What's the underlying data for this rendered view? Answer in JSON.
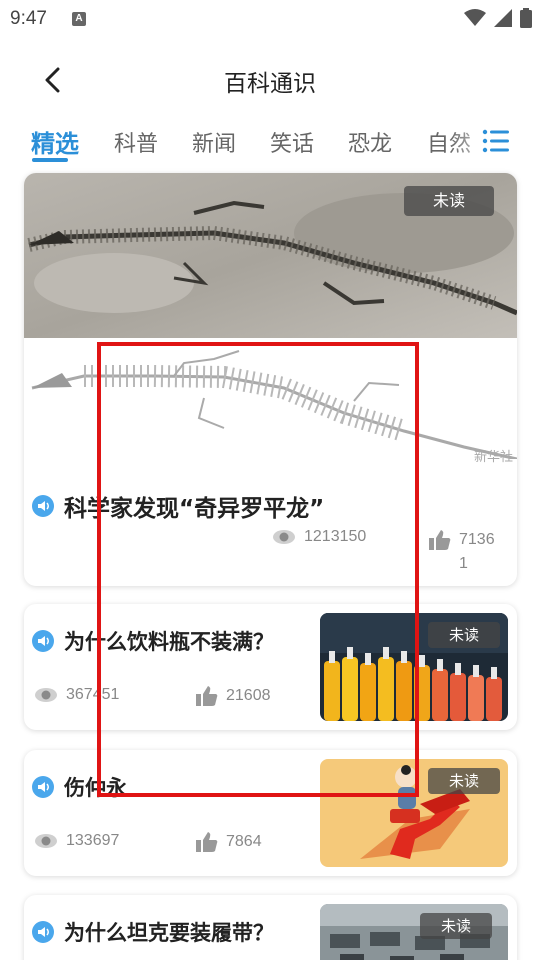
{
  "status_bar": {
    "time": "9:47",
    "notification_glyph": "A",
    "icons": [
      "wifi-icon",
      "signal-icon",
      "battery-icon"
    ]
  },
  "header": {
    "title": "百科通识",
    "back_icon": "chevron-left-icon"
  },
  "tabs": [
    {
      "label": "精选",
      "active": true
    },
    {
      "label": "科普",
      "active": false
    },
    {
      "label": "新闻",
      "active": false
    },
    {
      "label": "笑话",
      "active": false
    },
    {
      "label": "恐龙",
      "active": false
    },
    {
      "label": "自然",
      "active": false
    }
  ],
  "menu_icon": "list-menu-icon",
  "featured": {
    "badge": "未读",
    "watermark": "新华社",
    "title": "科学家发现“奇异罗平龙”",
    "views": "1213150",
    "likes_line1": "7136",
    "likes_line2": "1"
  },
  "articles": [
    {
      "title": "为什么饮料瓶不装满？",
      "views": "367451",
      "likes": "21608",
      "badge": "未读"
    },
    {
      "title": "伤仲永",
      "views": "133697",
      "likes": "7864",
      "badge": "未读"
    },
    {
      "title": "为什么坦克要装履带？",
      "badge": "未读"
    }
  ],
  "colors": {
    "accent": "#2b8fd8",
    "highlight_box": "#e01414",
    "speaker": "#4aa7ec"
  }
}
